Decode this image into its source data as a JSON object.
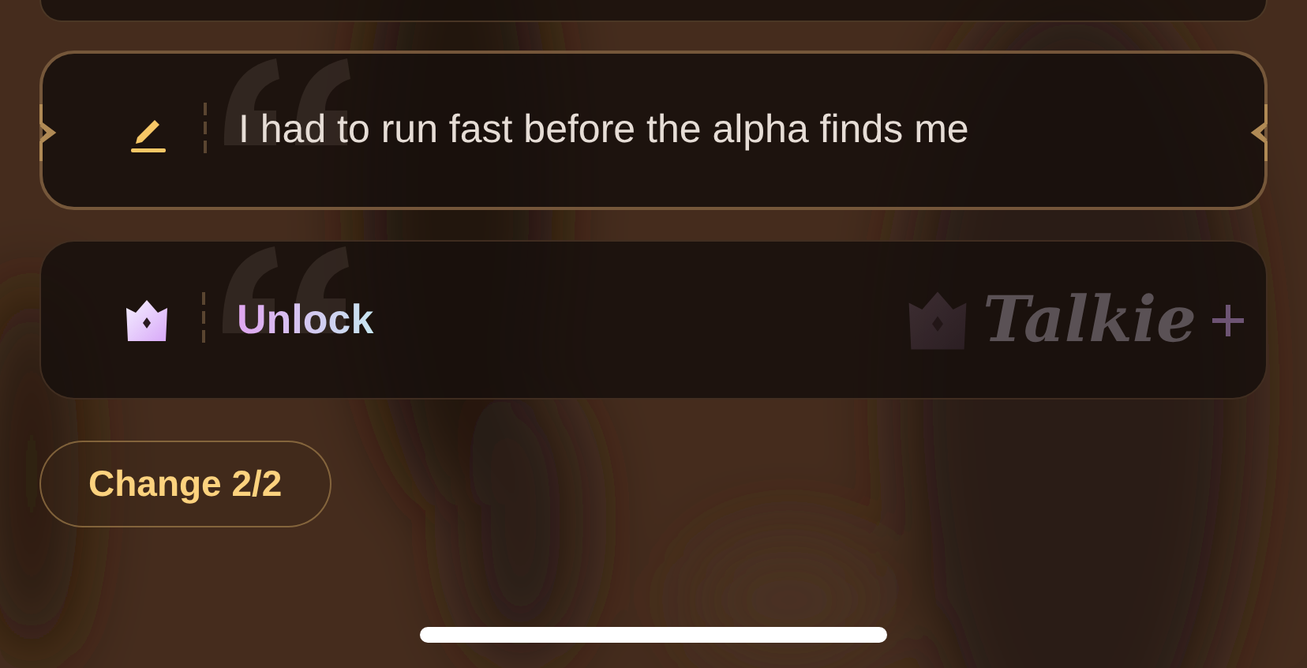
{
  "options": [
    {
      "kind": "prompt",
      "text": "I had to run fast before the alpha finds me",
      "selected": true
    },
    {
      "kind": "unlock",
      "text": "Unlock",
      "selected": false,
      "brand": "Talkie"
    }
  ],
  "change_button": "Change 2/2"
}
